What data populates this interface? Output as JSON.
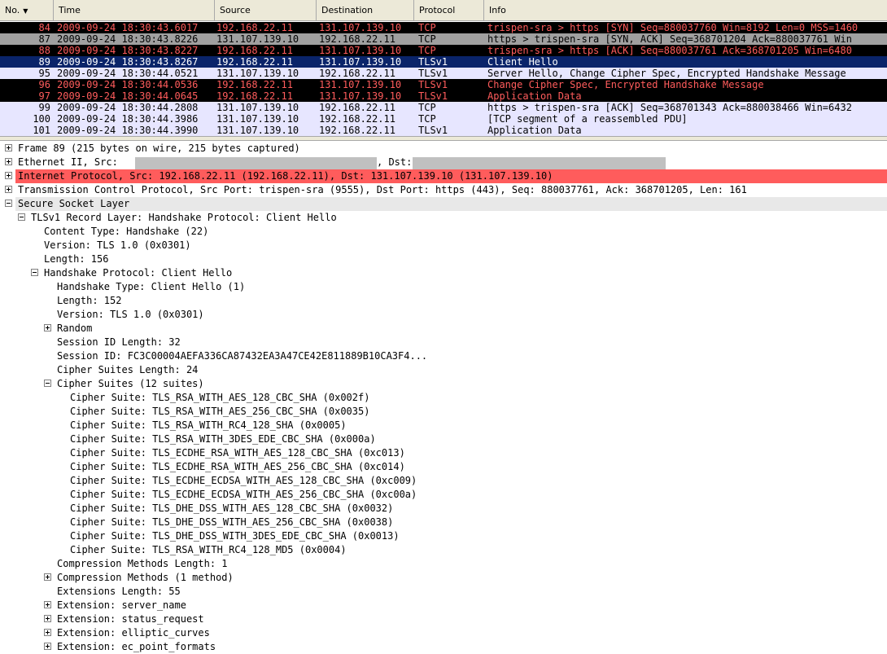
{
  "columns": [
    "No.",
    "Time",
    "Source",
    "Destination",
    "Protocol",
    "Info"
  ],
  "packets": [
    {
      "no": "84",
      "time": "2009-09-24 18:30:43.6017",
      "src": "192.168.22.11",
      "dst": "131.107.139.10",
      "proto": "TCP",
      "info": "trispen-sra > https [SYN] Seq=880037760 Win=8192 Len=0 MSS=1460",
      "style": "bad"
    },
    {
      "no": "87",
      "time": "2009-09-24 18:30:43.8226",
      "src": "131.107.139.10",
      "dst": "192.168.22.11",
      "proto": "TCP",
      "info": "https > trispen-sra [SYN, ACK] Seq=368701204 Ack=880037761 Win",
      "style": "synack"
    },
    {
      "no": "88",
      "time": "2009-09-24 18:30:43.8227",
      "src": "192.168.22.11",
      "dst": "131.107.139.10",
      "proto": "TCP",
      "info": "trispen-sra > https [ACK] Seq=880037761 Ack=368701205 Win=6480",
      "style": "bad"
    },
    {
      "no": "89",
      "time": "2009-09-24 18:30:43.8267",
      "src": "192.168.22.11",
      "dst": "131.107.139.10",
      "proto": "TLSv1",
      "info": "Client Hello",
      "style": "sel"
    },
    {
      "no": "95",
      "time": "2009-09-24 18:30:44.0521",
      "src": "131.107.139.10",
      "dst": "192.168.22.11",
      "proto": "TLSv1",
      "info": "Server Hello, Change Cipher Spec, Encrypted Handshake Message",
      "style": "tls"
    },
    {
      "no": "96",
      "time": "2009-09-24 18:30:44.0536",
      "src": "192.168.22.11",
      "dst": "131.107.139.10",
      "proto": "TLSv1",
      "info": "Change Cipher Spec, Encrypted Handshake Message",
      "style": "bad"
    },
    {
      "no": "97",
      "time": "2009-09-24 18:30:44.0645",
      "src": "192.168.22.11",
      "dst": "131.107.139.10",
      "proto": "TLSv1",
      "info": "Application Data",
      "style": "bad"
    },
    {
      "no": "99",
      "time": "2009-09-24 18:30:44.2808",
      "src": "131.107.139.10",
      "dst": "192.168.22.11",
      "proto": "TCP",
      "info": "https > trispen-sra [ACK] Seq=368701343 Ack=880038466 Win=6432",
      "style": "tcp"
    },
    {
      "no": "100",
      "time": "2009-09-24 18:30:44.3986",
      "src": "131.107.139.10",
      "dst": "192.168.22.11",
      "proto": "TCP",
      "info": "[TCP segment of a reassembled PDU]",
      "style": "tcp"
    },
    {
      "no": "101",
      "time": "2009-09-24 18:30:44.3990",
      "src": "131.107.139.10",
      "dst": "192.168.22.11",
      "proto": "TLSv1",
      "info": "Application Data",
      "style": "tls"
    }
  ],
  "details": [
    {
      "text": "Frame 89 (215 bytes on wire, 215 bytes captured)",
      "indent": 0,
      "toggle": "plus"
    },
    {
      "text": "Ethernet II, Src:",
      "text2": ", Dst:",
      "indent": 0,
      "toggle": "plus",
      "redacted": true
    },
    {
      "text": "Internet Protocol, Src: 192.168.22.11 (192.168.22.11), Dst: 131.107.139.10 (131.107.139.10)",
      "indent": 0,
      "toggle": "plus",
      "hl": "ip-hl"
    },
    {
      "text": "Transmission Control Protocol, Src Port: trispen-sra (9555), Dst Port: https (443), Seq: 880037761, Ack: 368701205, Len: 161",
      "indent": 0,
      "toggle": "plus"
    },
    {
      "text": "Secure Socket Layer",
      "indent": 0,
      "toggle": "minus",
      "hl": "ssl-bg"
    },
    {
      "text": "TLSv1 Record Layer: Handshake Protocol: Client Hello",
      "indent": 1,
      "toggle": "minus"
    },
    {
      "text": "Content Type: Handshake (22)",
      "indent": 2
    },
    {
      "text": "Version: TLS 1.0 (0x0301)",
      "indent": 2
    },
    {
      "text": "Length: 156",
      "indent": 2
    },
    {
      "text": "Handshake Protocol: Client Hello",
      "indent": 2,
      "toggle": "minus"
    },
    {
      "text": "Handshake Type: Client Hello (1)",
      "indent": 3
    },
    {
      "text": "Length: 152",
      "indent": 3
    },
    {
      "text": "Version: TLS 1.0 (0x0301)",
      "indent": 3
    },
    {
      "text": "Random",
      "indent": 3,
      "toggle": "plus"
    },
    {
      "text": "Session ID Length: 32",
      "indent": 3
    },
    {
      "text": "Session ID: FC3C00004AEFA336CA87432EA3A47CE42E811889B10CA3F4...",
      "indent": 3
    },
    {
      "text": "Cipher Suites Length: 24",
      "indent": 3
    },
    {
      "text": "Cipher Suites (12 suites)",
      "indent": 3,
      "toggle": "minus"
    },
    {
      "text": "Cipher Suite: TLS_RSA_WITH_AES_128_CBC_SHA (0x002f)",
      "indent": 4
    },
    {
      "text": "Cipher Suite: TLS_RSA_WITH_AES_256_CBC_SHA (0x0035)",
      "indent": 4
    },
    {
      "text": "Cipher Suite: TLS_RSA_WITH_RC4_128_SHA (0x0005)",
      "indent": 4
    },
    {
      "text": "Cipher Suite: TLS_RSA_WITH_3DES_EDE_CBC_SHA (0x000a)",
      "indent": 4
    },
    {
      "text": "Cipher Suite: TLS_ECDHE_RSA_WITH_AES_128_CBC_SHA (0xc013)",
      "indent": 4
    },
    {
      "text": "Cipher Suite: TLS_ECDHE_RSA_WITH_AES_256_CBC_SHA (0xc014)",
      "indent": 4
    },
    {
      "text": "Cipher Suite: TLS_ECDHE_ECDSA_WITH_AES_128_CBC_SHA (0xc009)",
      "indent": 4
    },
    {
      "text": "Cipher Suite: TLS_ECDHE_ECDSA_WITH_AES_256_CBC_SHA (0xc00a)",
      "indent": 4
    },
    {
      "text": "Cipher Suite: TLS_DHE_DSS_WITH_AES_128_CBC_SHA (0x0032)",
      "indent": 4
    },
    {
      "text": "Cipher Suite: TLS_DHE_DSS_WITH_AES_256_CBC_SHA (0x0038)",
      "indent": 4
    },
    {
      "text": "Cipher Suite: TLS_DHE_DSS_WITH_3DES_EDE_CBC_SHA (0x0013)",
      "indent": 4
    },
    {
      "text": "Cipher Suite: TLS_RSA_WITH_RC4_128_MD5 (0x0004)",
      "indent": 4
    },
    {
      "text": "Compression Methods Length: 1",
      "indent": 3
    },
    {
      "text": "Compression Methods (1 method)",
      "indent": 3,
      "toggle": "plus"
    },
    {
      "text": "Extensions Length: 55",
      "indent": 3
    },
    {
      "text": "Extension: server_name",
      "indent": 3,
      "toggle": "plus"
    },
    {
      "text": "Extension: status_request",
      "indent": 3,
      "toggle": "plus"
    },
    {
      "text": "Extension: elliptic_curves",
      "indent": 3,
      "toggle": "plus"
    },
    {
      "text": "Extension: ec_point_formats",
      "indent": 3,
      "toggle": "plus"
    }
  ]
}
